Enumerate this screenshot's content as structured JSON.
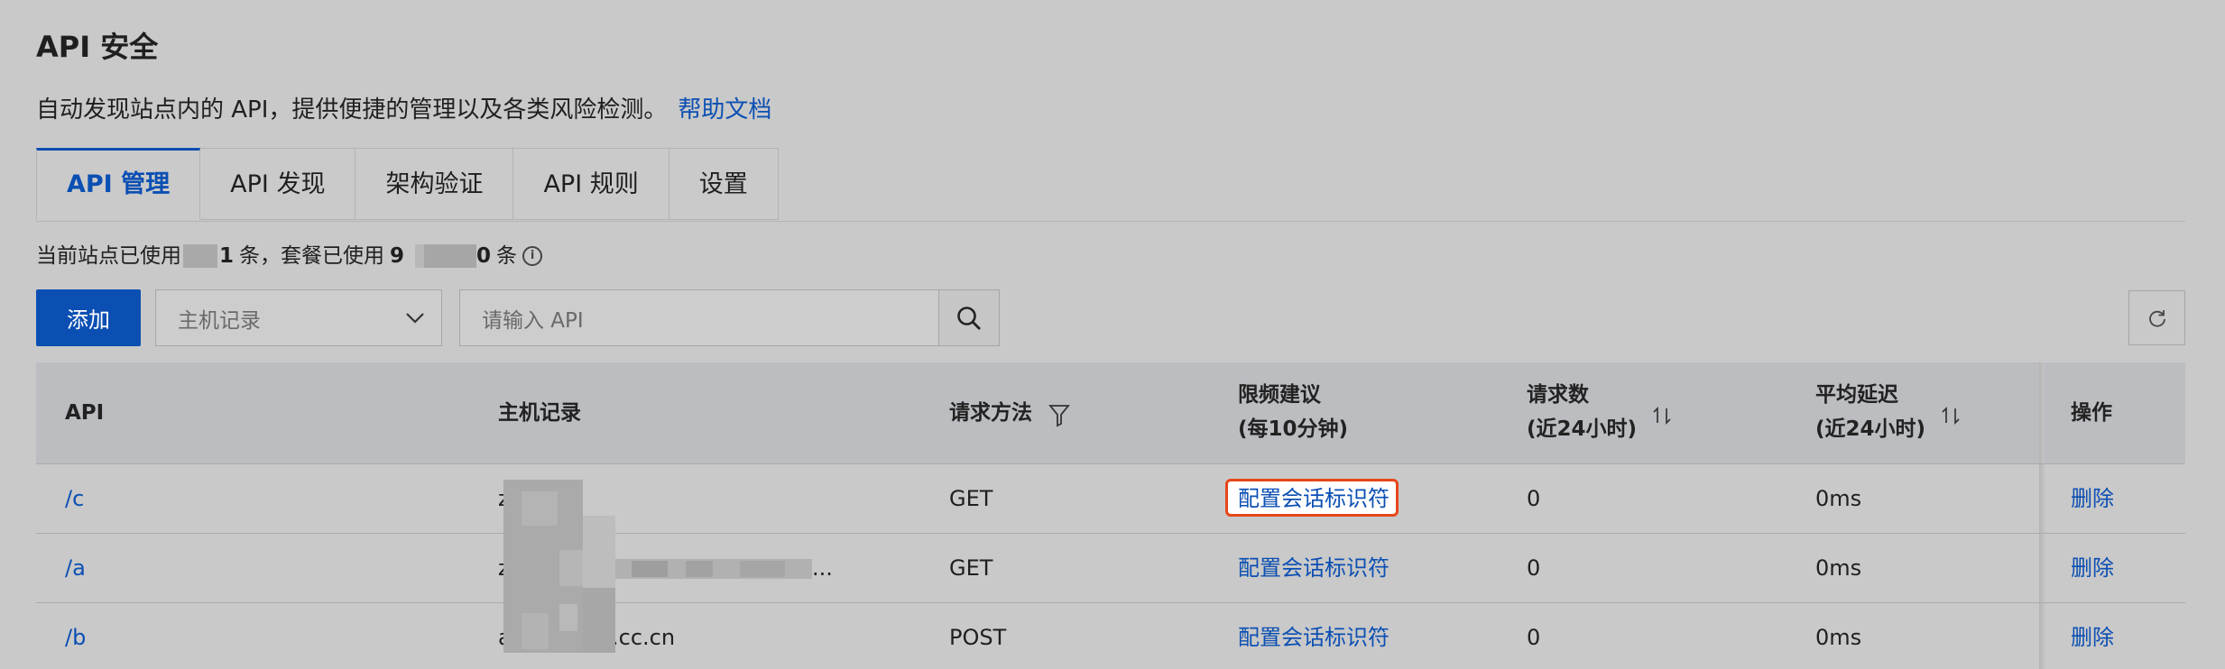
{
  "header": {
    "title": "API 安全",
    "description": "自动发现站点内的 API，提供便捷的管理以及各类风险检测。",
    "help_link": "帮助文档"
  },
  "tabs": [
    {
      "label": "API 管理",
      "active": true
    },
    {
      "label": "API 发现",
      "active": false
    },
    {
      "label": "架构验证",
      "active": false
    },
    {
      "label": "API 规则",
      "active": false
    },
    {
      "label": "设置",
      "active": false
    }
  ],
  "usage": {
    "prefix": "当前站点已使用",
    "site_count_visible": "1",
    "unit1": "条，套餐已使用",
    "plan_count_start": "9",
    "plan_count_end": "0",
    "unit2": "条"
  },
  "toolbar": {
    "add_label": "添加",
    "select_placeholder": "主机记录",
    "search_placeholder": "请输入 API"
  },
  "table": {
    "columns": {
      "api": "API",
      "host": "主机记录",
      "method": "请求方法",
      "rate_line1": "限频建议",
      "rate_line2": "(每10分钟)",
      "requests_line1": "请求数",
      "requests_line2": "(近24小时)",
      "latency_line1": "平均延迟",
      "latency_line2": "(近24小时)",
      "actions": "操作"
    },
    "rows": [
      {
        "api": "/c",
        "host": "z",
        "method": "GET",
        "rate": "配置会话标识符",
        "requests": "0",
        "latency": "0ms",
        "action": "删除"
      },
      {
        "api": "/a",
        "host": "z",
        "host_tail": "...",
        "method": "GET",
        "rate": "配置会话标识符",
        "requests": "0",
        "latency": "0ms",
        "action": "删除"
      },
      {
        "api": "/b",
        "host": "a",
        "host_tail": ".cc.cn",
        "method": "POST",
        "rate": "配置会话标识符",
        "requests": "0",
        "latency": "0ms",
        "action": "删除"
      }
    ]
  },
  "colors": {
    "accent": "#0b4fb3",
    "highlight_border": "#e6461a",
    "background": "#c9c9c9",
    "table_header": "#bbbdc1"
  }
}
